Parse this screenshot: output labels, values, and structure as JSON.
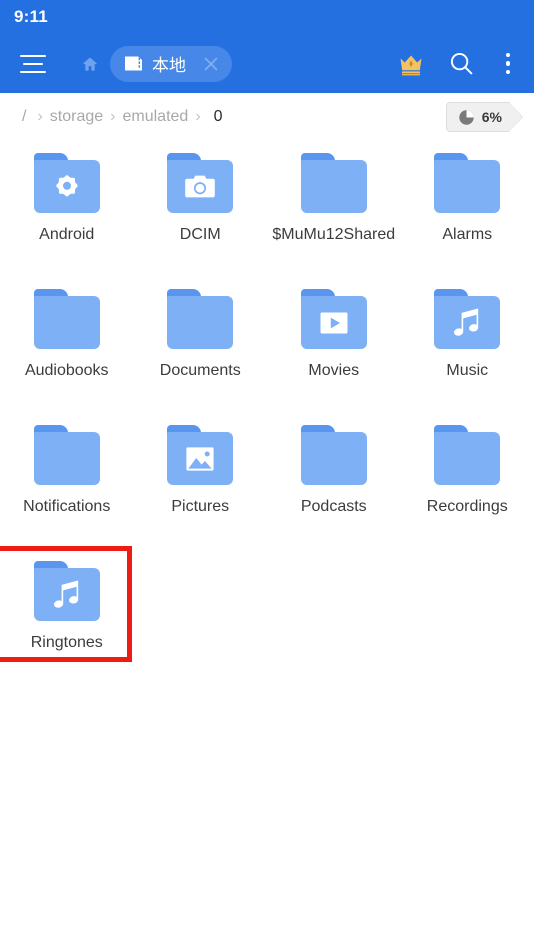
{
  "status_bar": {
    "time": "9:11"
  },
  "toolbar": {
    "menu_icon": "hamburger-menu-icon",
    "home_icon": "home-icon",
    "tab": {
      "icon": "sd-card-icon",
      "label": "本地",
      "close_icon": "close-icon"
    },
    "crown_icon": "crown-icon",
    "search_icon": "search-icon",
    "more_icon": "more-vertical-icon"
  },
  "breadcrumb": {
    "root": "/",
    "separator": "›",
    "items": [
      "storage",
      "emulated"
    ],
    "current": "0"
  },
  "storage_badge": {
    "icon": "pie-chart-icon",
    "percent": "6%"
  },
  "files": [
    {
      "name": "Android",
      "glyph": "gear-icon",
      "selected": false
    },
    {
      "name": "DCIM",
      "glyph": "camera-icon",
      "selected": false
    },
    {
      "name": "$MuMu12Shared",
      "glyph": "none",
      "selected": false
    },
    {
      "name": "Alarms",
      "glyph": "none",
      "selected": false
    },
    {
      "name": "Audiobooks",
      "glyph": "none",
      "selected": false
    },
    {
      "name": "Documents",
      "glyph": "none",
      "selected": false
    },
    {
      "name": "Movies",
      "glyph": "video-icon",
      "selected": false
    },
    {
      "name": "Music",
      "glyph": "music-note-icon",
      "selected": false
    },
    {
      "name": "Notifications",
      "glyph": "none",
      "selected": false
    },
    {
      "name": "Pictures",
      "glyph": "image-icon",
      "selected": false
    },
    {
      "name": "Podcasts",
      "glyph": "none",
      "selected": false
    },
    {
      "name": "Recordings",
      "glyph": "none",
      "selected": false
    },
    {
      "name": "Ringtones",
      "glyph": "music-note-icon",
      "selected": true
    }
  ],
  "colors": {
    "header_blue": "#2570e0",
    "tab_chip_blue": "#4787e8",
    "folder_body": "#7eb0f5",
    "folder_tab": "#5a96f0",
    "selection_red": "#ee1c14",
    "crown_gold": "#f2c263",
    "label_text": "#3c3c3c",
    "crumb_inactive": "#a8a8a8"
  }
}
